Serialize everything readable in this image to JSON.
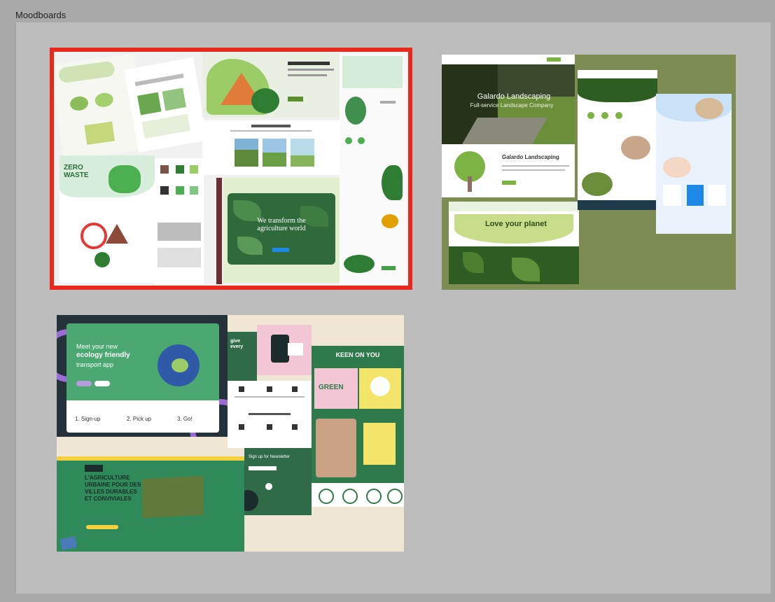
{
  "frame": {
    "title": "Moodboards"
  },
  "boards": [
    {
      "id": "board-1",
      "selected": true,
      "texts": {
        "zero_waste": "ZERO WASTE",
        "transform": "We transform the agriculture world"
      }
    },
    {
      "id": "board-2",
      "selected": false,
      "texts": {
        "hero": "Galardo Landscaping",
        "hero_sub": "Full-service Landscape Company",
        "about_title": "Galardo Landscaping",
        "planet": "Love your planet"
      }
    },
    {
      "id": "board-3",
      "selected": false,
      "texts": {
        "eco_line1": "Meet your new",
        "eco_line2": "ecology friendly",
        "eco_line3": "transport app",
        "step1": "1. Sign-up",
        "step2": "2. Pick up",
        "step3": "3. Go!",
        "give": "give every",
        "green": "GREEN",
        "keen": "KEEN ON YOU",
        "agri1": "L'AGRICULTURE",
        "agri2": "URBAINE POUR DES",
        "agri3": "VILLES DURABLES",
        "agri4": "ET CONVIVIALES",
        "signup": "Sign up for Newsletter"
      }
    }
  ],
  "colors": {
    "selection": "#e8281b",
    "canvas": "#bdbdbd",
    "chrome": "#a9a9a9",
    "olive": "#7c8c52",
    "eco_green": "#4a9a6a",
    "dark_green": "#2f7a4a"
  }
}
